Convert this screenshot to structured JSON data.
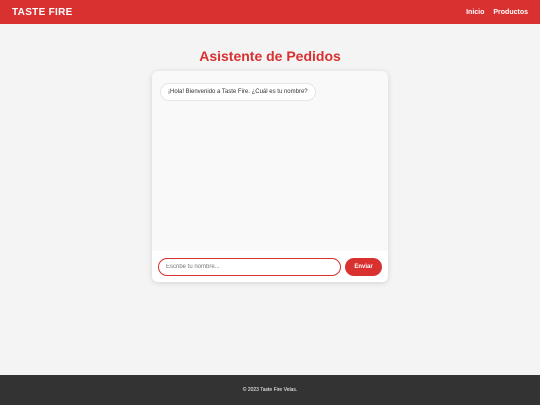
{
  "header": {
    "brand": "TASTE FIRE",
    "nav": [
      "Inicio",
      "Productos"
    ]
  },
  "main": {
    "title": "Asistente de Pedidos",
    "chat": {
      "messages": [
        {
          "sender": "bot",
          "text": "¡Hola! Bienvenido a Taste Fire. ¿Cuál es tu nombre?"
        }
      ],
      "input": {
        "value": "",
        "placeholder": "Escribe tu nombre..."
      },
      "send_label": "Enviar"
    }
  },
  "footer": {
    "text": "© 2023 Taste Fire Velas."
  },
  "colors": {
    "accent": "#d93030",
    "background": "#f4f4f4",
    "footer": "#333333"
  }
}
